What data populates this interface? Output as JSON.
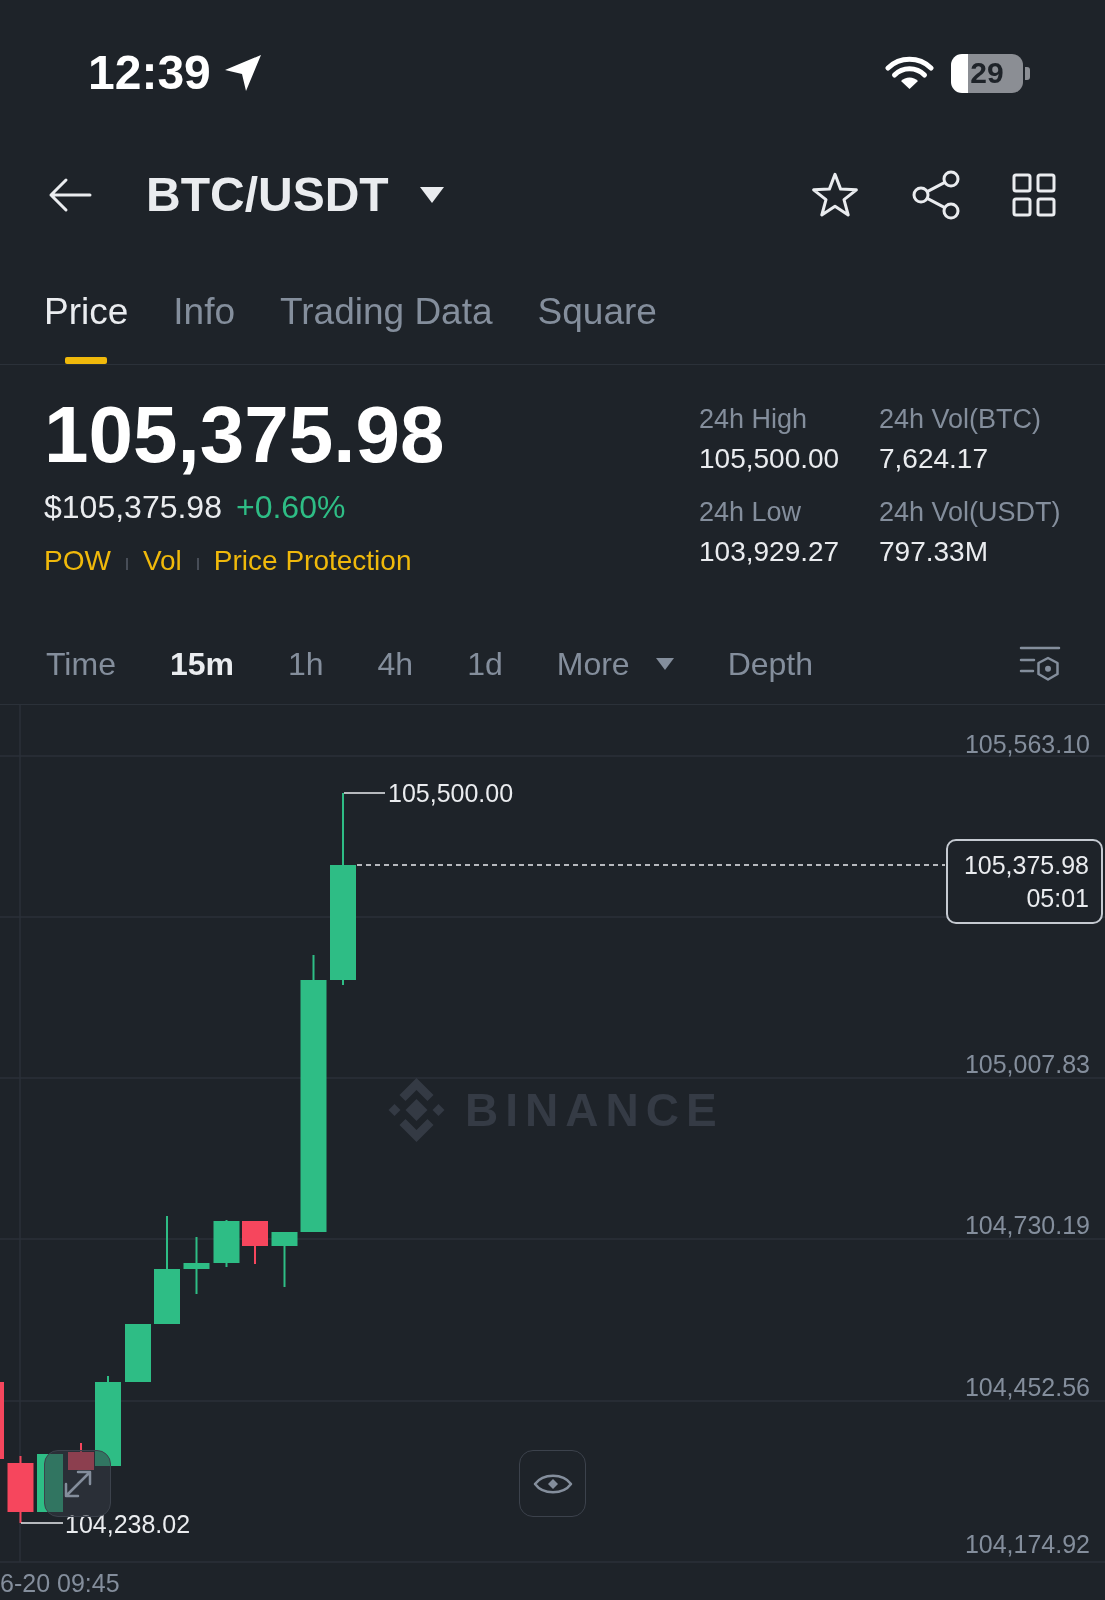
{
  "status_bar": {
    "time": "12:39",
    "battery": "29"
  },
  "header": {
    "title": "BTC/USDT"
  },
  "tabs": [
    {
      "label": "Price",
      "selected": true
    },
    {
      "label": "Info",
      "selected": false
    },
    {
      "label": "Trading Data",
      "selected": false
    },
    {
      "label": "Square",
      "selected": false
    }
  ],
  "ticker": {
    "last_price": "105,375.98",
    "fiat_price": "$105,375.98",
    "change": "+0.60%",
    "tags": [
      "POW",
      "Vol",
      "Price Protection"
    ]
  },
  "stats": [
    {
      "label": "24h High",
      "value": "105,500.00"
    },
    {
      "label": "24h Vol(BTC)",
      "value": "7,624.17"
    },
    {
      "label": "24h Low",
      "value": "103,929.27"
    },
    {
      "label": "24h Vol(USDT)",
      "value": "797.33M"
    }
  ],
  "intervals": [
    {
      "label": "Time",
      "kind": "option",
      "selected": false
    },
    {
      "label": "15m",
      "kind": "option",
      "selected": true
    },
    {
      "label": "1h",
      "kind": "option",
      "selected": false
    },
    {
      "label": "4h",
      "kind": "option",
      "selected": false
    },
    {
      "label": "1d",
      "kind": "option",
      "selected": false
    },
    {
      "label": "More",
      "kind": "menu",
      "selected": false
    },
    {
      "label": "Depth",
      "kind": "option",
      "selected": false
    }
  ],
  "chart": {
    "price_axis": [
      "105,563.10",
      "105,007.83",
      "104,730.19",
      "104,452.56",
      "104,174.92"
    ],
    "high_label": "105,500.00",
    "low_label": "104,238.02",
    "last_price": "105,375.98",
    "countdown": "05:01",
    "watermark": "BINANCE",
    "time_label": "6-20 09:45"
  }
}
